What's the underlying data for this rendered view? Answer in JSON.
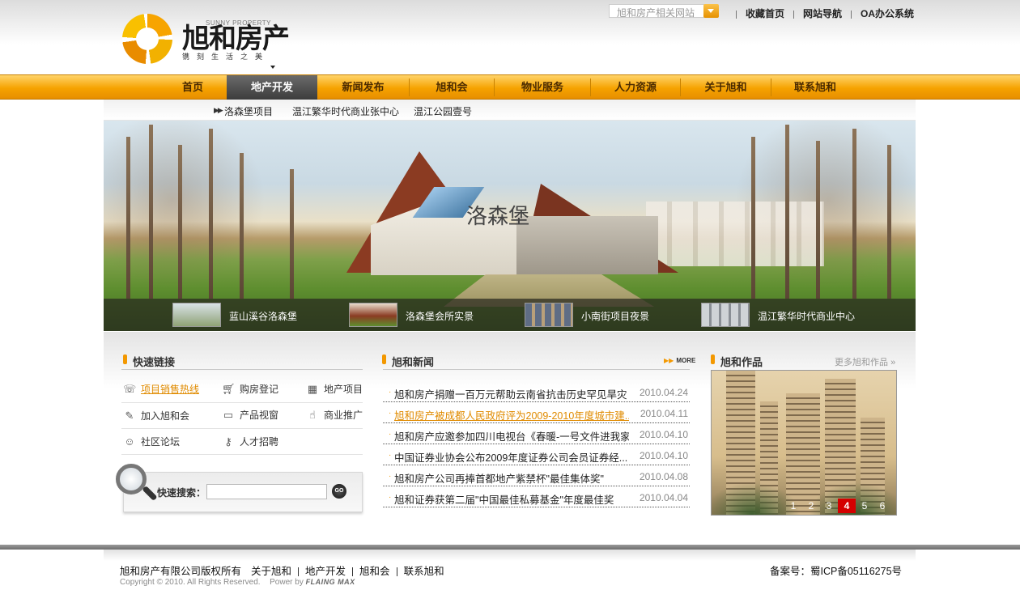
{
  "header": {
    "logo_en": "SUNNY PROPERTY",
    "logo_cn": "旭和房产",
    "logo_slogan": "镌刻生活之美",
    "site_search_placeholder": "旭和房产相关网站",
    "top_links": [
      "收藏首页",
      "网站导航",
      "OA办公系统"
    ]
  },
  "nav": {
    "items": [
      "首页",
      "地产开发",
      "新闻发布",
      "旭和会",
      "物业服务",
      "人力资源",
      "关于旭和",
      "联系旭和"
    ],
    "active": "地产开发"
  },
  "subnav": {
    "items": [
      "洛森堡项目",
      "温江繁华时代商业张中心",
      "温江公园壹号"
    ]
  },
  "banner": {
    "sign_text": "洛森堡",
    "thumbs": [
      "蓝山溪谷洛森堡",
      "洛森堡会所实景",
      "小南街项目夜景",
      "温江繁华时代商业中心"
    ]
  },
  "quick_links": {
    "title": "快速链接",
    "items": [
      {
        "label": "项目销售热线",
        "icon": "hotline-icon",
        "highlighted": true
      },
      {
        "label": "购房登记",
        "icon": "cart-icon"
      },
      {
        "label": "地产项目",
        "icon": "building-icon"
      },
      {
        "label": "加入旭和会",
        "icon": "pen-icon"
      },
      {
        "label": "产品视窗",
        "icon": "chat-icon"
      },
      {
        "label": "商业推广",
        "icon": "hand-pointer-icon"
      },
      {
        "label": "社区论坛",
        "icon": "people-icon"
      },
      {
        "label": "人才招聘",
        "icon": "key-icon"
      }
    ],
    "search_label": "快速搜索：",
    "search_button": "GO"
  },
  "news": {
    "title": "旭和新闻",
    "more": "MORE",
    "items": [
      {
        "title": "旭和房产捐赠一百万元帮助云南省抗击历史罕见旱灾",
        "date": "2010.04.24"
      },
      {
        "title": "旭和房产被成都人民政府评为2009-2010年度城市建...",
        "date": "2010.04.11",
        "highlighted": true
      },
      {
        "title": "旭和房产应邀参加四川电视台《春暖-一号文件进我家...",
        "date": "2010.04.10"
      },
      {
        "title": "中国证券业协会公布2009年度证券公司会员证券经...",
        "date": "2010.04.10"
      },
      {
        "title": "旭和房产公司再捧首都地产紫禁杯\"最佳集体奖\"",
        "date": "2010.04.08"
      },
      {
        "title": "旭和证券获第二届\"中国最佳私募基金\"年度最佳奖",
        "date": "2010.04.04"
      }
    ]
  },
  "works": {
    "title": "旭和作品",
    "more": "更多旭和作品",
    "pages": [
      "1",
      "2",
      "3",
      "4",
      "5",
      "6"
    ],
    "active_page": "4"
  },
  "footer": {
    "links": [
      "旭和房产有限公司版权所有",
      "关于旭和",
      "地产开发",
      "旭和会",
      "联系旭和"
    ],
    "copyright": "Copyright © 2010. All Rights Reserved.",
    "power_by": "Power by",
    "power_brand": "FLAING MAX",
    "icp": "备案号：蜀ICP备05116275号"
  },
  "colors": {
    "accent": "#f39800",
    "nav_active": "#4a4a4a",
    "pager_active": "#d40000",
    "link_highlight": "#e08b00"
  }
}
